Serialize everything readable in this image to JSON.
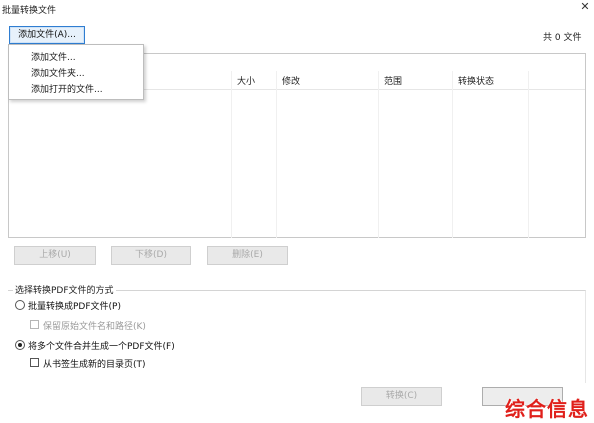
{
  "window": {
    "title": "批量转换文件",
    "close_glyph": "✕"
  },
  "toolbar": {
    "add_button_label": "添加文件(A)...",
    "count_text": "共 0 文件"
  },
  "menu": {
    "items": [
      "添加文件...",
      "添加文件夹...",
      "添加打开的文件..."
    ]
  },
  "list": {
    "columns": [
      "大小",
      "修改",
      "范围",
      "转换状态"
    ]
  },
  "actions": {
    "move_up": "上移(U)",
    "move_down": "下移(D)",
    "delete": "删除(E)"
  },
  "mode": {
    "group_title": "选择转换PDF文件的方式",
    "option_batch": "批量转换成PDF文件(P)",
    "option_keep_names": "保留原始文件名和路径(K)",
    "option_merge": "将多个文件合并生成一个PDF文件(F)",
    "option_bookmarks": "从书签生成新的目录页(T)",
    "selected": "merge"
  },
  "footer": {
    "convert_label": "转换(C)"
  },
  "watermark": {
    "text": "综合信息"
  }
}
